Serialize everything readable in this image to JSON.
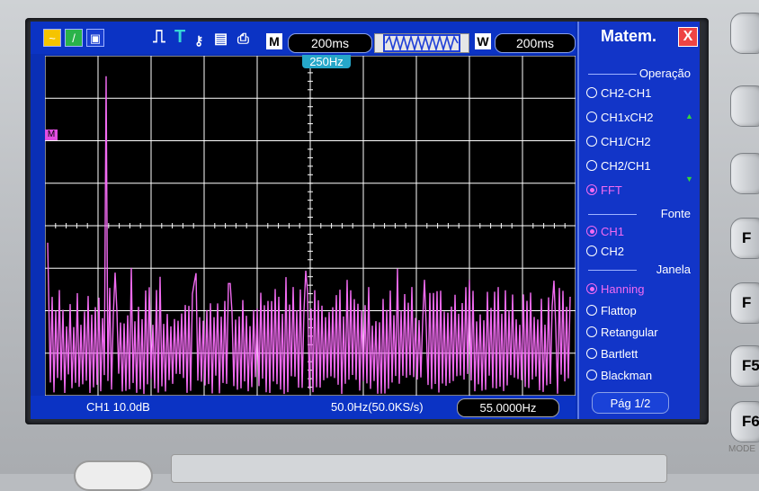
{
  "topbar": {
    "icons": [
      "math-waveform-icon",
      "cursor-icon",
      "print-icon",
      "pulse-icon",
      "trigger-T-icon",
      "key-icon",
      "floppy-icon",
      "printer-icon"
    ],
    "timebase_badge": "M",
    "timebase": "200ms",
    "window_badge": "W",
    "window_timebase": "200ms",
    "trigger_position": "250Hz"
  },
  "menu": {
    "title": "Matem.",
    "close_label": "X",
    "sections": {
      "operation": {
        "label": "Operação",
        "options": [
          "CH2-CH1",
          "CH1xCH2",
          "CH1/CH2",
          "CH2/CH1",
          "FFT"
        ],
        "selected": "FFT"
      },
      "source": {
        "label": "Fonte",
        "options": [
          "CH1",
          "CH2"
        ],
        "selected": "CH1"
      },
      "window": {
        "label": "Janela",
        "options": [
          "Hanning",
          "Flattop",
          "Retangular",
          "Bartlett",
          "Blackman"
        ],
        "selected": "Hanning"
      }
    },
    "page": "Pág  1/2"
  },
  "status": {
    "channel": "CH1  10.0dB",
    "span": "50.0Hz(50.0KS/s)",
    "center_freq": "55.0000Hz"
  },
  "markers": {
    "math": "M"
  },
  "softkeys": [
    "",
    "",
    "",
    "F",
    "F",
    "F5",
    "F6"
  ],
  "mode_label": "MODE",
  "colors": {
    "trace": "#f26bf2",
    "screen_bg": "#0a2fb5",
    "grid": "#ffffff",
    "trigger_marker": "#26a7c9"
  },
  "trace_peaks": {
    "main_peak": 0.94,
    "secondary_peak": 0.33
  }
}
